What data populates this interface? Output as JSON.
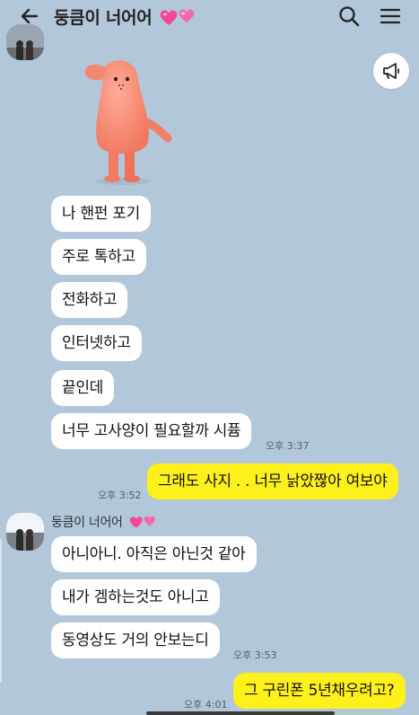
{
  "header": {
    "title": "둥큼이 너어어",
    "icons": {
      "back": "arrow-left-icon",
      "search": "search-icon",
      "menu": "hamburger-menu-icon"
    }
  },
  "colors": {
    "background": "#b2c7da",
    "my_bubble": "#fef01b",
    "their_bubble": "#ffffff",
    "heart": "#f0479b"
  },
  "sticker": {
    "name": "saluting-pink-character-sticker"
  },
  "notice_button": {
    "icon": "megaphone-icon"
  },
  "messages_group1": [
    {
      "text": "나 핸펀 포기"
    },
    {
      "text": "주로 톡하고"
    },
    {
      "text": "전화하고"
    },
    {
      "text": "인터넷하고"
    },
    {
      "text": "끝인데"
    },
    {
      "text": "너무 고사양이 필요할까 시퓸",
      "time": "오후 3:37"
    }
  ],
  "my_message1": {
    "text": "그래도 사지 . . 너무 낡았짢아 여보야",
    "time": "오후 3:52"
  },
  "sender": {
    "name": "둥큼이 너어어"
  },
  "messages_group2": [
    {
      "text": "아니아니. 아직은 아닌것 같아"
    },
    {
      "text": "내가 겜하는것도 아니고"
    },
    {
      "text": "동영상도 거의 안보는디",
      "time": "오후 3:53"
    }
  ],
  "my_message2": {
    "text": "그 구린폰 5년채우려고?",
    "time": "오후 4:01"
  }
}
